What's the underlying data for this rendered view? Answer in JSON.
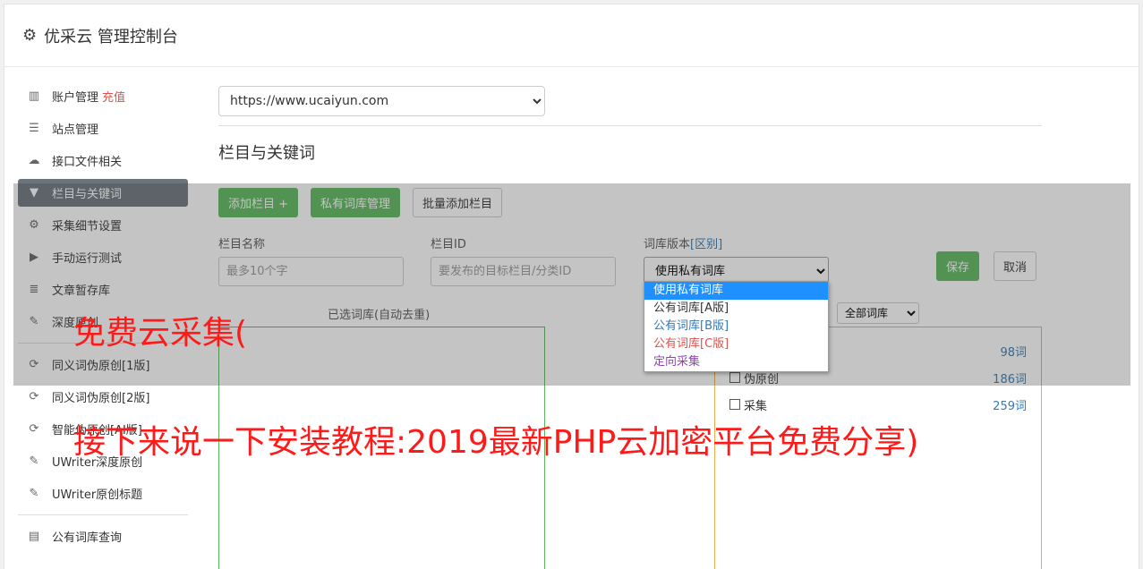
{
  "header": {
    "title": "优采云 管理控制台",
    "icon": "gear-icon"
  },
  "sidebar": {
    "items": [
      {
        "label": "账户管理",
        "icon": "bar-chart-icon",
        "badge": "充值"
      },
      {
        "label": "站点管理",
        "icon": "server-icon"
      },
      {
        "label": "接口文件相关",
        "icon": "cloud-upload-icon"
      },
      {
        "label": "栏目与关键词",
        "icon": "filter-icon",
        "active": true
      },
      {
        "label": "采集细节设置",
        "icon": "gears-icon"
      },
      {
        "label": "手动运行测试",
        "icon": "play-circle-icon"
      },
      {
        "label": "文章暂存库",
        "icon": "database-icon"
      },
      {
        "label": "深度原创",
        "icon": "edit-icon"
      },
      {
        "label": "同义词伪原创[1版]",
        "icon": "refresh-icon"
      },
      {
        "label": "同义词伪原创[2版]",
        "icon": "refresh-icon"
      },
      {
        "label": "智能伪原创[AI版]",
        "icon": "refresh-icon"
      },
      {
        "label": "UWriter深度原创",
        "icon": "edit-icon"
      },
      {
        "label": "UWriter原创标题",
        "icon": "edit-icon"
      },
      {
        "label": "公有词库查询",
        "icon": "book-icon"
      }
    ]
  },
  "main": {
    "site_select": "https://www.ucaiyun.com",
    "section_title": "栏目与关键词",
    "buttons": {
      "add_column": "添加栏目 +",
      "private_lib": "私有词库管理",
      "batch_add": "批量添加栏目"
    },
    "fields": {
      "name_label": "栏目名称",
      "name_placeholder": "最多10个字",
      "id_label": "栏目ID",
      "id_placeholder": "要发布的目标栏目/分类ID",
      "lib_label": "词库版本",
      "lib_label_diff": "[区别]",
      "lib_value": "使用私有词库"
    },
    "save": "保存",
    "cancel": "取消",
    "dropdown_options": [
      "使用私有词库",
      "公有词库[A版]",
      "公有词库[B版]",
      "公有词库[C版]",
      "定向采集"
    ],
    "chosen_label": "已选词库(自动去重)",
    "lib_filter": "全部词库",
    "libs": [
      {
        "name": "",
        "count": "98词"
      },
      {
        "name": "伪原创",
        "count": "186词"
      },
      {
        "name": "采集",
        "count": "259词"
      }
    ]
  },
  "captions": {
    "line1": "免费云采集(",
    "line2": "接下来说一下安装教程:2019最新PHP云加密平台免费分享)"
  },
  "colors": {
    "accent_green": "#5cb85c",
    "active_nav": "#6c757d",
    "caption_red": "#ff1a1a",
    "link_blue": "#337ab7"
  }
}
